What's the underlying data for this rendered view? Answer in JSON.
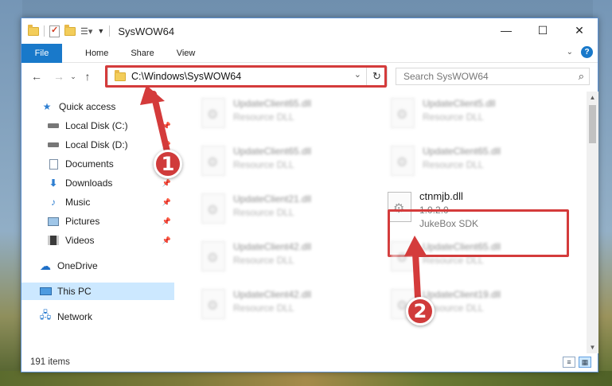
{
  "window": {
    "title": "SysWOW64",
    "controls": {
      "minimize": "—",
      "maximize": "☐",
      "close": "✕"
    }
  },
  "ribbon": {
    "tabs": [
      "File",
      "Home",
      "Share",
      "View"
    ],
    "expand_icon": "chevron-down-icon",
    "help_label": "?"
  },
  "address": {
    "path": "C:\\Windows\\SysWOW64",
    "search_placeholder": "Search SysWOW64"
  },
  "sidebar": {
    "items": [
      {
        "label": "Quick access",
        "icon": "star-icon",
        "pinned": false
      },
      {
        "label": "Local Disk (C:)",
        "icon": "drive-icon",
        "pinned": true
      },
      {
        "label": "Local Disk (D:)",
        "icon": "drive-icon",
        "pinned": true
      },
      {
        "label": "Documents",
        "icon": "documents-icon",
        "pinned": true
      },
      {
        "label": "Downloads",
        "icon": "downloads-icon",
        "pinned": true
      },
      {
        "label": "Music",
        "icon": "music-icon",
        "pinned": true
      },
      {
        "label": "Pictures",
        "icon": "pictures-icon",
        "pinned": true
      },
      {
        "label": "Videos",
        "icon": "videos-icon",
        "pinned": true
      },
      {
        "label": "OneDrive",
        "icon": "cloud-icon",
        "pinned": false
      },
      {
        "label": "This PC",
        "icon": "computer-icon",
        "pinned": false,
        "selected": true
      },
      {
        "label": "Network",
        "icon": "network-icon",
        "pinned": false
      }
    ]
  },
  "files": [
    {
      "name": "UpdateClient65.dll",
      "desc": "Resource DLL"
    },
    {
      "name": "UpdateClient5.dll",
      "desc": "Resource DLL"
    },
    {
      "name": "UpdateClient65.dll",
      "desc": "Resource DLL"
    },
    {
      "name": "UpdateClient65.dll",
      "desc": "Resource DLL"
    },
    {
      "name": "UpdateClient21.dll",
      "desc": "Resource DLL"
    },
    {
      "name": "ctnmjb.dll",
      "version": "1.0.2.0",
      "desc": "JukeBox SDK"
    },
    {
      "name": "UpdateClient42.dll",
      "desc": "Resource DLL"
    },
    {
      "name": "UpdateClient65.dll",
      "desc": "Resource DLL"
    },
    {
      "name": "UpdateClient42.dll",
      "desc": "Resource DLL"
    },
    {
      "name": "UpdateClient19.dll",
      "desc": "Resource DLL"
    }
  ],
  "status": {
    "item_count": "191 items"
  },
  "annotations": {
    "step1": "1",
    "step2": "2",
    "color": "#d43b3b"
  }
}
